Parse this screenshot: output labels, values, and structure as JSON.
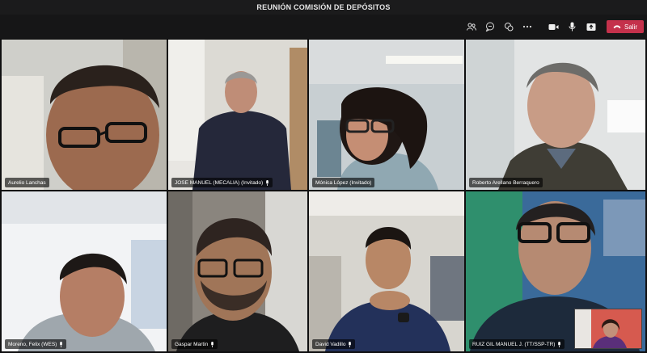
{
  "window": {
    "title": "REUNIÓN COMISIÓN DE DEPÓSITOS"
  },
  "toolbar": {
    "icons": [
      "people-icon",
      "chat-icon",
      "reactions-icon",
      "more-icon",
      "camera-icon",
      "mic-icon",
      "share-icon"
    ],
    "leave_label": "Salir",
    "leave_color": "#c4314b"
  },
  "participants": [
    {
      "name": "Aurelio Lanchas"
    },
    {
      "name": "JOSE MANUEL (MECALIA) (Invitado)"
    },
    {
      "name": "Mónica López (Invitado)"
    },
    {
      "name": "Roberto Arellano Berraquero"
    },
    {
      "name": "Moreno, Felix (WES)"
    },
    {
      "name": "Gaspar Martin"
    },
    {
      "name": "David Vadillo"
    },
    {
      "name": "RUIZ GIL MANUEL J. (TT/SSP-TR)"
    }
  ]
}
